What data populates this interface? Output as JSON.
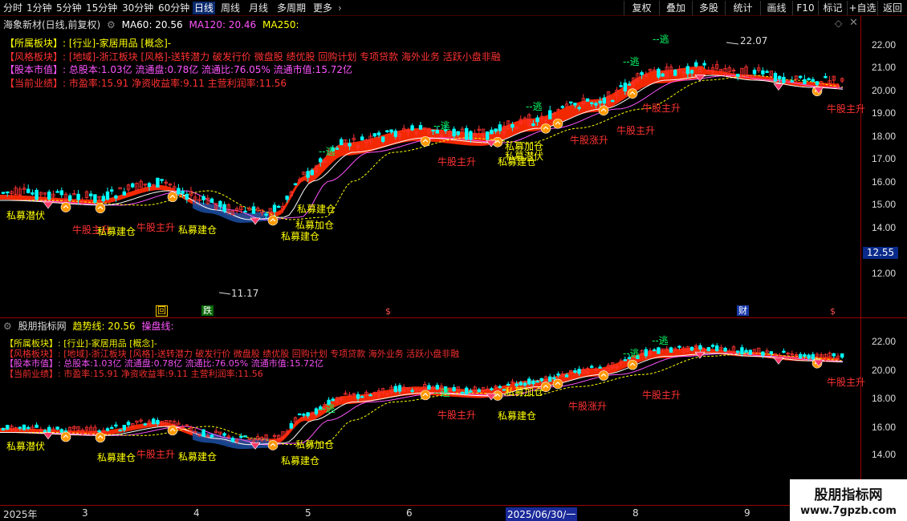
{
  "toolbar": {
    "timeframes": [
      "分时",
      "1分钟",
      "5分钟",
      "15分钟",
      "30分钟",
      "60分钟",
      "日线",
      "周线",
      "月线",
      "多周期",
      "更多"
    ],
    "active_timeframe": "日线",
    "buttons": [
      "复权",
      "叠加",
      "多股",
      "统计",
      "画线",
      "F10",
      "标记",
      "+自选",
      "返回"
    ]
  },
  "main_panel": {
    "stock_title": "海象新材(日线,前复权)",
    "ma60": "MA60: 20.56",
    "ma120": "MA120: 20.46",
    "ma250": "MA250:",
    "info": [
      {
        "label": "【所属板块】:",
        "value": "[行业]-家居用品 [概念]-"
      },
      {
        "label": "【风格板块】:",
        "value": "[地域]-浙江板块 [风格]-送转潜力 破发行价 微盘股 绩优股 回购计划 专项贷款 海外业务 活跃小盘非融"
      },
      {
        "label": "【股本市值】:",
        "value": "总股本:1.03亿 流通盘:0.78亿 流通比:76.05% 流通市值:15.72亿"
      },
      {
        "label": "【当前业绩】:",
        "value": "市盈率:15.91 净资收益率:9.11 主营利润率:11.56"
      }
    ],
    "y_ticks": [
      "22.00",
      "21.00",
      "20.00",
      "19.00",
      "18.00",
      "17.00",
      "16.00",
      "15.00",
      "14.00",
      "13.00",
      "12.00"
    ],
    "current_price": "12.55",
    "high_label": "22.07",
    "low_label": "11.17",
    "markers": [
      "回",
      "跌",
      "$",
      "财",
      "$"
    ]
  },
  "sub_panel": {
    "title": "股朋指标网",
    "trend_line": "趋势线: 20.56",
    "operate_line": "操盘线:",
    "y_ticks": [
      "22.00",
      "20.00",
      "18.00",
      "16.00",
      "14.00"
    ]
  },
  "signals": {
    "escape": "逃",
    "private_build": "私募建仓",
    "private_add": "私募加仓",
    "private_hide": "私募潜伏",
    "bull_rise": "牛股主升",
    "bull_surge": "牛股涨升"
  },
  "x_axis": {
    "labels": [
      "2025年",
      "3",
      "4",
      "5",
      "6",
      "2025/06/30/一",
      "8",
      "9"
    ]
  },
  "watermark": {
    "name": "股朋指标网",
    "url": "www.7gpzb.com"
  },
  "colors": {
    "up": "#ff3232",
    "down": "#00ffff",
    "ma60": "#ffffff",
    "ma120": "#ff55ff",
    "ma250": "#ffff00",
    "trend_band": "#ff2a00",
    "grid_border": "#990000"
  }
}
